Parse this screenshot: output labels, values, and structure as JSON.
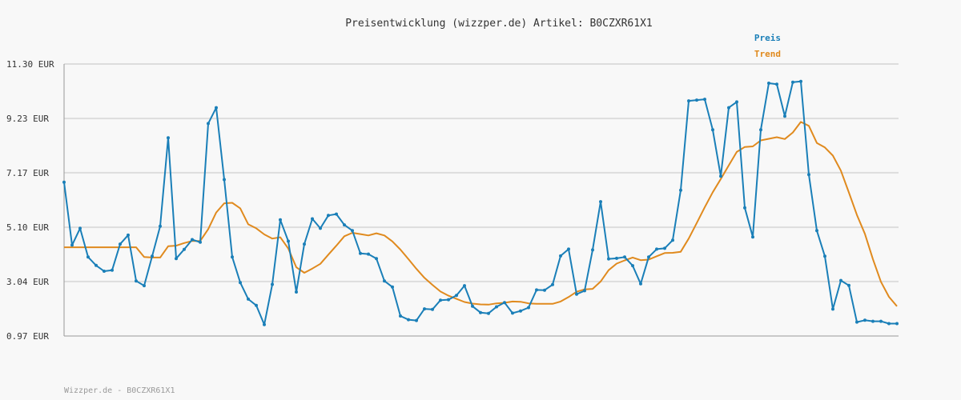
{
  "chart_data": {
    "type": "line",
    "title": "Preisentwicklung (wizzper.de) Artikel: B0CZXR61X1",
    "ylabel": "",
    "xlabel": "",
    "ylim": [
      0.97,
      11.3
    ],
    "yticks": [
      0.97,
      3.04,
      5.1,
      7.17,
      9.23,
      11.3
    ],
    "ytick_labels": [
      "0.97 EUR",
      "3.04 EUR",
      "5.10 EUR",
      "7.17 EUR",
      "9.23 EUR",
      "11.30 EUR"
    ],
    "grid": true,
    "legend_position": "top-right",
    "series": [
      {
        "name": "Preis",
        "color": "#1a7fb8",
        "markers": true,
        "values": [
          6.81,
          4.42,
          5.06,
          3.97,
          3.65,
          3.43,
          3.47,
          4.46,
          4.8,
          3.06,
          2.88,
          4.0,
          5.14,
          8.5,
          3.91,
          4.26,
          4.63,
          4.53,
          9.04,
          9.64,
          6.91,
          3.97,
          3.0,
          2.37,
          2.13,
          1.4,
          2.93,
          5.38,
          4.57,
          2.64,
          4.46,
          5.42,
          5.06,
          5.55,
          5.6,
          5.19,
          4.97,
          4.11,
          4.08,
          3.91,
          3.06,
          2.83,
          1.73,
          1.59,
          1.56,
          2.0,
          1.98,
          2.33,
          2.35,
          2.51,
          2.88,
          2.1,
          1.86,
          1.83,
          2.08,
          2.24,
          1.84,
          1.92,
          2.05,
          2.72,
          2.71,
          2.92,
          4.01,
          4.27,
          2.56,
          2.69,
          4.24,
          6.07,
          3.9,
          3.92,
          3.97,
          3.64,
          2.95,
          3.97,
          4.27,
          4.3,
          4.61,
          6.51,
          9.9,
          9.93,
          9.96,
          8.8,
          7.04,
          9.64,
          9.86,
          5.84,
          4.73,
          8.8,
          10.57,
          10.53,
          9.32,
          10.61,
          10.64,
          7.1,
          4.97,
          4.0,
          1.99,
          3.08,
          2.89,
          1.5,
          1.57,
          1.53,
          1.53,
          1.44,
          1.44
        ]
      },
      {
        "name": "Trend",
        "color": "#e08a1e",
        "markers": false,
        "values": [
          4.34,
          4.34,
          4.34,
          4.34,
          4.34,
          4.34,
          4.34,
          4.34,
          4.34,
          4.34,
          3.97,
          3.95,
          3.95,
          4.38,
          4.4,
          4.5,
          4.58,
          4.58,
          5.03,
          5.66,
          6.01,
          6.03,
          5.82,
          5.21,
          5.06,
          4.83,
          4.67,
          4.72,
          4.29,
          3.58,
          3.37,
          3.53,
          3.71,
          4.06,
          4.4,
          4.76,
          4.89,
          4.84,
          4.79,
          4.87,
          4.79,
          4.56,
          4.25,
          3.89,
          3.52,
          3.18,
          2.91,
          2.66,
          2.5,
          2.38,
          2.26,
          2.2,
          2.17,
          2.16,
          2.21,
          2.23,
          2.28,
          2.27,
          2.21,
          2.19,
          2.19,
          2.19,
          2.28,
          2.45,
          2.65,
          2.74,
          2.76,
          3.04,
          3.47,
          3.72,
          3.84,
          3.95,
          3.85,
          3.87,
          4.0,
          4.12,
          4.13,
          4.17,
          4.67,
          5.26,
          5.86,
          6.43,
          6.93,
          7.45,
          7.96,
          8.15,
          8.17,
          8.4,
          8.46,
          8.52,
          8.45,
          8.7,
          9.1,
          8.95,
          8.3,
          8.13,
          7.82,
          7.25,
          6.42,
          5.57,
          4.85,
          3.89,
          3.03,
          2.46,
          2.1
        ]
      }
    ]
  },
  "footer_text": "Wizzper.de - B0CZXR61X1"
}
